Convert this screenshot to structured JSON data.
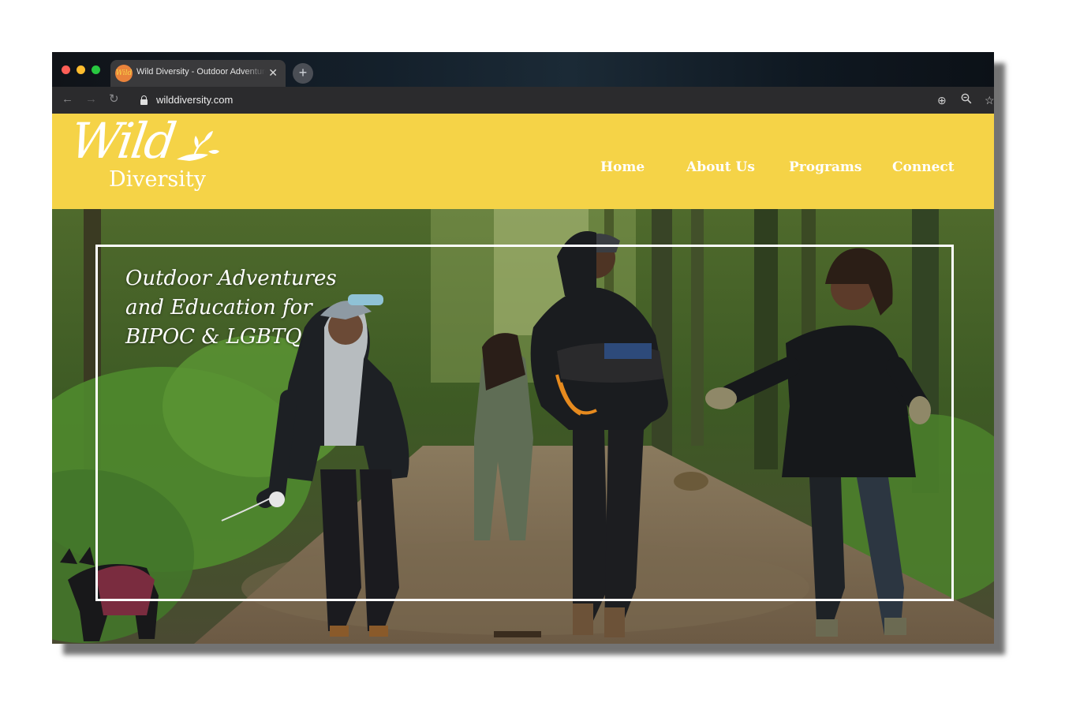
{
  "browser": {
    "tab_title": "Wild Diversity - Outdoor Adventures",
    "tab_close": "✕",
    "new_tab": "+",
    "url": "wilddiversity.com",
    "icons": [
      "back-arrow-icon",
      "forward-arrow-icon",
      "reload-icon",
      "lock-icon",
      "add-icon",
      "zoom-out-icon",
      "bookmark-star-icon"
    ]
  },
  "site": {
    "logo": {
      "wild": "Wild",
      "diversity": "Diversity"
    },
    "nav": [
      "Home",
      "About Us",
      "Programs",
      "Connect"
    ],
    "hero": {
      "tagline_line1": "Outdoor Adventures",
      "tagline_line2": "and Education for",
      "tagline_line3": "BIPOC & LGBTQ"
    }
  },
  "colors": {
    "header_yellow": "#f5d347",
    "forest_green": "#3f5a2a",
    "frame_white": "#ffffff"
  }
}
